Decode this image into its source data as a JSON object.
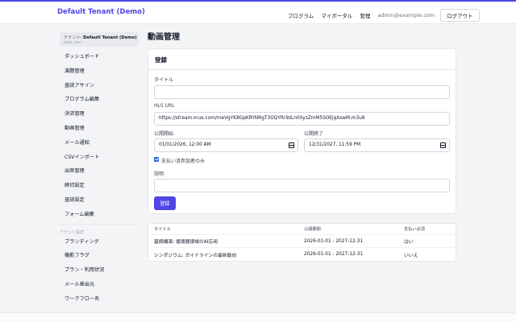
{
  "header": {
    "brand": "Default Tenant (Demo)",
    "nav_program": "プログラム",
    "nav_myportal": "マイポータル",
    "nav_admin": "管理",
    "user_email": "admin@example.com",
    "logout_label": "ログアウト"
  },
  "sidebar": {
    "tenant_prefix": "テナント:",
    "tenant_name": "Default Tenant (Demo)",
    "tenant_plan": "plan: pro",
    "items": [
      {
        "label": "ダッシュボード"
      },
      {
        "label": "演題管理"
      },
      {
        "label": "査読アサイン"
      },
      {
        "label": "プログラム編集"
      },
      {
        "label": "決済管理"
      },
      {
        "label": "動画管理"
      },
      {
        "label": "メール通知"
      },
      {
        "label": "CSVインポート"
      },
      {
        "label": "出席管理"
      },
      {
        "label": "締切設定"
      },
      {
        "label": "査読設定"
      },
      {
        "label": "フォーム編集"
      }
    ],
    "section_label": "テナント設定",
    "tenant_items": [
      {
        "label": "ブランディング"
      },
      {
        "label": "機能フラグ"
      },
      {
        "label": "プラン・利用状況"
      },
      {
        "label": "メール差出元"
      },
      {
        "label": "ワークフロー名"
      }
    ]
  },
  "main": {
    "page_title": "動画管理",
    "form": {
      "heading": "登録",
      "title_label": "タイトル",
      "title_value": "",
      "hls_label": "HLS URL",
      "hls_value": "https://stream.mux.com/meVgYK8GpKRYNRgT3OQYRr9zLn00yzZmM5SOEjqXswM.m3u8",
      "start_label": "公開開始",
      "start_value": "01/01/2026, 12:00 AM",
      "end_label": "公開終了",
      "end_value": "12/31/2027, 11:59 PM",
      "paid_only_label": "支払い済参加者のみ",
      "paid_only_checked": true,
      "description_label": "説明",
      "description_value": "",
      "submit_label": "登録"
    },
    "table": {
      "headers": [
        "タイトル",
        "公開期間",
        "支払い必須"
      ],
      "rows": [
        [
          "基調講演: 循環器領域のAI応用",
          "2026-01-01 - 2027-12-31",
          "はい"
        ],
        [
          "シンポジウム: ガイドラインの最新動向",
          "2026-01-01 - 2027-12-31",
          "いいえ"
        ]
      ]
    }
  },
  "colors": {
    "accent": "#4f46e5",
    "checkbox": "#2563eb",
    "background": "#f3f4f6"
  }
}
